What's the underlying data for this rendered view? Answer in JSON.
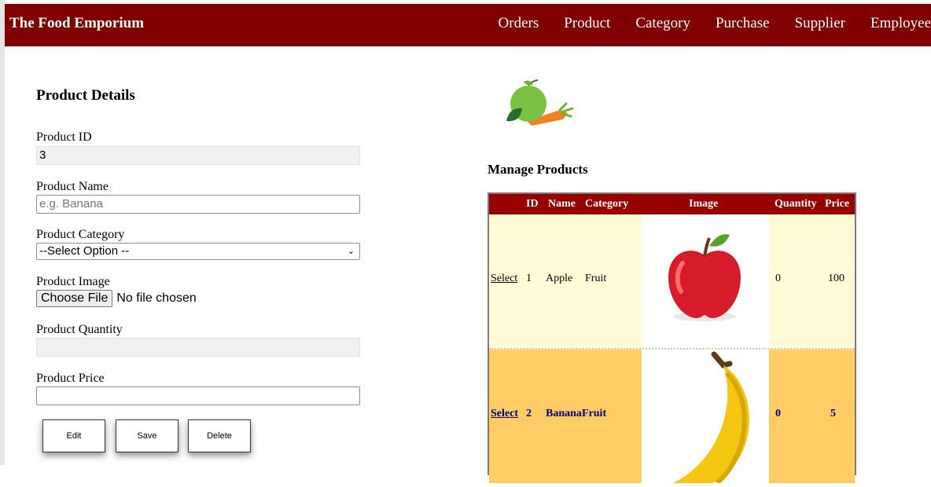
{
  "header": {
    "brand": "The Food Emporium",
    "nav": [
      "Orders",
      "Product",
      "Category",
      "Purchase",
      "Supplier",
      "Employee"
    ]
  },
  "form": {
    "title": "Product Details",
    "product_id": {
      "label": "Product ID",
      "value": "3"
    },
    "product_name": {
      "label": "Product Name",
      "placeholder": "e.g. Banana",
      "value": ""
    },
    "product_category": {
      "label": "Product Category",
      "selected": "--Select Option --"
    },
    "product_image": {
      "label": "Product Image",
      "button": "Choose File",
      "status": "No file chosen"
    },
    "product_quantity": {
      "label": "Product Quantity",
      "value": ""
    },
    "product_price": {
      "label": "Product Price",
      "value": ""
    },
    "buttons": {
      "edit": "Edit",
      "save": "Save",
      "delete": "Delete"
    }
  },
  "table": {
    "title": "Manage Products",
    "headers": [
      "ID",
      "Name",
      "Category",
      "Image",
      "Quantity",
      "Price"
    ],
    "rows": [
      {
        "select": "Select",
        "id": "1",
        "name": "Apple",
        "category": "Fruit",
        "image": "apple-image",
        "quantity": "0",
        "price": "100"
      },
      {
        "select": "Select",
        "id": "2",
        "name": "Banana",
        "category": "Fruit",
        "image": "banana-image",
        "quantity": "0",
        "price": "5"
      }
    ]
  },
  "colors": {
    "navbar": "#800000",
    "table_header": "#990000",
    "row_normal": "#fffbd6",
    "row_selected": "#ffcc66",
    "row_selected_text": "#000080"
  }
}
